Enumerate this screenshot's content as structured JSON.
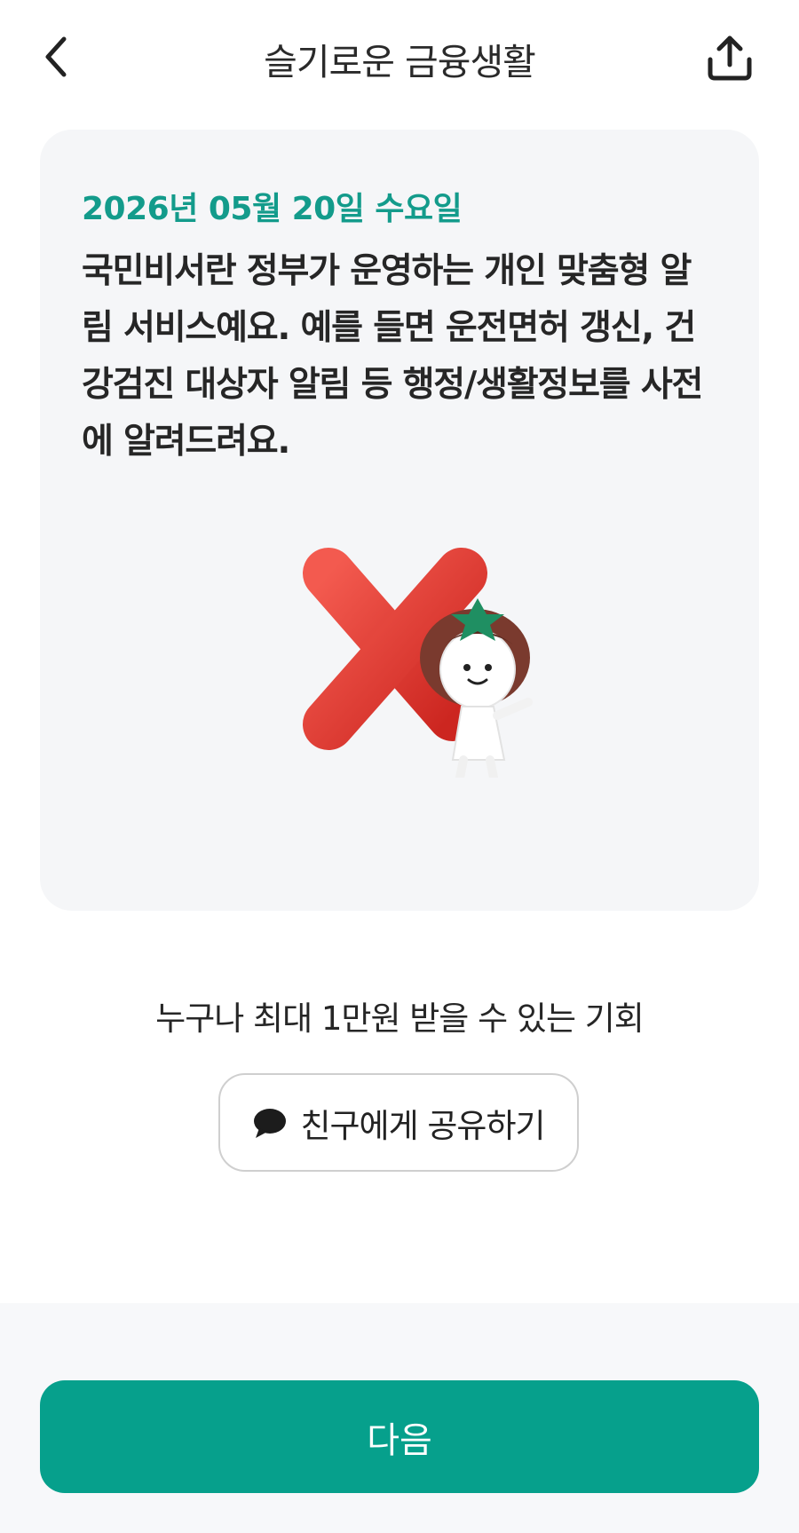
{
  "header": {
    "title": "슬기로운 금융생활",
    "back_icon": "chevron-left-icon",
    "share_icon": "upload-share-icon"
  },
  "card": {
    "date": "2026년 05월 20일 수요일",
    "description": "국민비서란 정부가 운영하는 개인 맞춤형 알림 서비스예요. 예를 들면 운전면허 갱신, 건강검진 대상자 알림 등 행정/생활정보를 사전에 알려드려요.",
    "illustration": "red-x-mark-with-mascot",
    "answer": "X"
  },
  "promo": {
    "text": "누구나 최대 1만원 받을 수 있는 기회"
  },
  "share_button": {
    "icon": "speech-bubble-icon",
    "label": "친구에게 공유하기"
  },
  "footer": {
    "next_label": "다음"
  },
  "colors": {
    "accent": "#06a08c",
    "date_text": "#139b8b",
    "card_bg": "#f5f6f8",
    "x_mark": "#e3362f"
  }
}
